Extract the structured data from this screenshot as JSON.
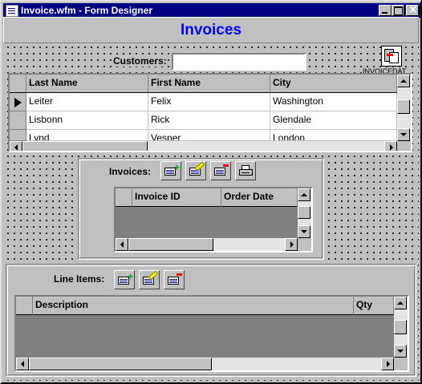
{
  "window": {
    "title": "Invoice.wfm - Form Designer",
    "controls": [
      "minimize",
      "maximize",
      "close"
    ]
  },
  "form": {
    "title": "Invoices",
    "title_color": "#0000ff"
  },
  "customers": {
    "label": "Customers:",
    "value": ""
  },
  "datamodule": {
    "label": "INVOICEDAT..."
  },
  "customer_grid": {
    "columns": [
      "Last Name",
      "First Name",
      "City"
    ],
    "rows": [
      [
        "Leiter",
        "Felix",
        "Washington"
      ],
      [
        "Lisbonn",
        "Rick",
        "Glendale"
      ],
      [
        "Lynd",
        "Vesper",
        "London"
      ]
    ]
  },
  "invoices": {
    "label": "Invoices:",
    "columns": [
      "Invoice ID",
      "Order Date"
    ],
    "toolbar": [
      "add-row-icon",
      "edit-row-icon",
      "delete-row-icon",
      "print-icon"
    ]
  },
  "line_items": {
    "label": "Line Items:",
    "columns": [
      "Description",
      "Qty"
    ],
    "toolbar": [
      "add-row-icon",
      "edit-row-icon",
      "delete-row-icon"
    ]
  },
  "colors": {
    "titlebar": "#000080",
    "face": "#c0c0c0",
    "empty_grid": "#808080"
  }
}
